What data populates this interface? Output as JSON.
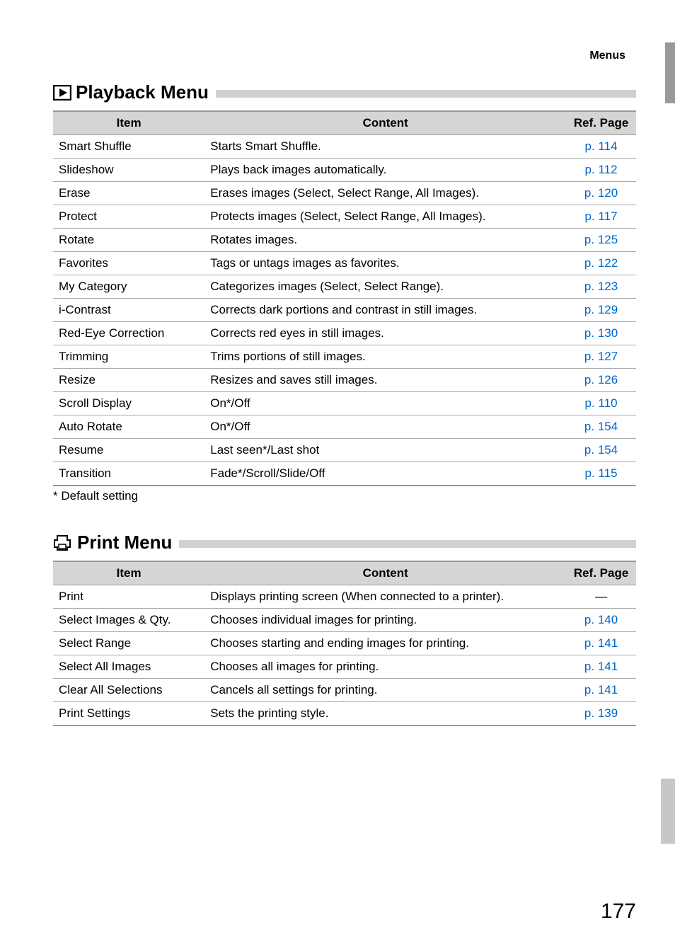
{
  "header": {
    "label": "Menus"
  },
  "sections": [
    {
      "title": "Playback Menu",
      "icon": "playback",
      "columns": [
        "Item",
        "Content",
        "Ref. Page"
      ],
      "rows": [
        {
          "item": "Smart Shuffle",
          "content": "Starts Smart Shuffle.",
          "ref": "p. 114"
        },
        {
          "item": "Slideshow",
          "content": "Plays back images automatically.",
          "ref": "p. 112"
        },
        {
          "item": "Erase",
          "content": "Erases images (Select, Select Range, All Images).",
          "ref": "p. 120"
        },
        {
          "item": "Protect",
          "content": "Protects images (Select, Select Range, All Images).",
          "ref": "p. 117"
        },
        {
          "item": "Rotate",
          "content": "Rotates images.",
          "ref": "p. 125"
        },
        {
          "item": "Favorites",
          "content": "Tags or untags images as favorites.",
          "ref": "p. 122"
        },
        {
          "item": "My Category",
          "content": "Categorizes images (Select, Select Range).",
          "ref": "p. 123"
        },
        {
          "item": "i-Contrast",
          "content": "Corrects dark portions and contrast in still images.",
          "ref": "p. 129"
        },
        {
          "item": "Red-Eye Correction",
          "content": "Corrects red eyes in still images.",
          "ref": "p. 130"
        },
        {
          "item": "Trimming",
          "content": "Trims portions of still images.",
          "ref": "p. 127"
        },
        {
          "item": "Resize",
          "content": "Resizes and saves still images.",
          "ref": "p. 126"
        },
        {
          "item": "Scroll Display",
          "content": "On*/Off",
          "ref": "p. 110"
        },
        {
          "item": "Auto Rotate",
          "content": "On*/Off",
          "ref": "p. 154"
        },
        {
          "item": "Resume",
          "content": "Last seen*/Last shot",
          "ref": "p. 154"
        },
        {
          "item": "Transition",
          "content": "Fade*/Scroll/Slide/Off",
          "ref": "p. 115"
        }
      ],
      "footnote": "* Default setting"
    },
    {
      "title": "Print Menu",
      "icon": "print",
      "columns": [
        "Item",
        "Content",
        "Ref. Page"
      ],
      "rows": [
        {
          "item": "Print",
          "content": "Displays printing screen (When connected to a printer).",
          "ref": "—",
          "refDash": true
        },
        {
          "item": "Select Images & Qty.",
          "content": "Chooses individual images for printing.",
          "ref": "p. 140"
        },
        {
          "item": "Select Range",
          "content": "Chooses starting and ending images for printing.",
          "ref": "p. 141"
        },
        {
          "item": "Select All Images",
          "content": "Chooses all images for printing.",
          "ref": "p. 141"
        },
        {
          "item": "Clear All Selections",
          "content": "Cancels all settings for printing.",
          "ref": "p. 141"
        },
        {
          "item": "Print Settings",
          "content": "Sets the printing style.",
          "ref": "p. 139"
        }
      ]
    }
  ],
  "pageNumber": "177"
}
